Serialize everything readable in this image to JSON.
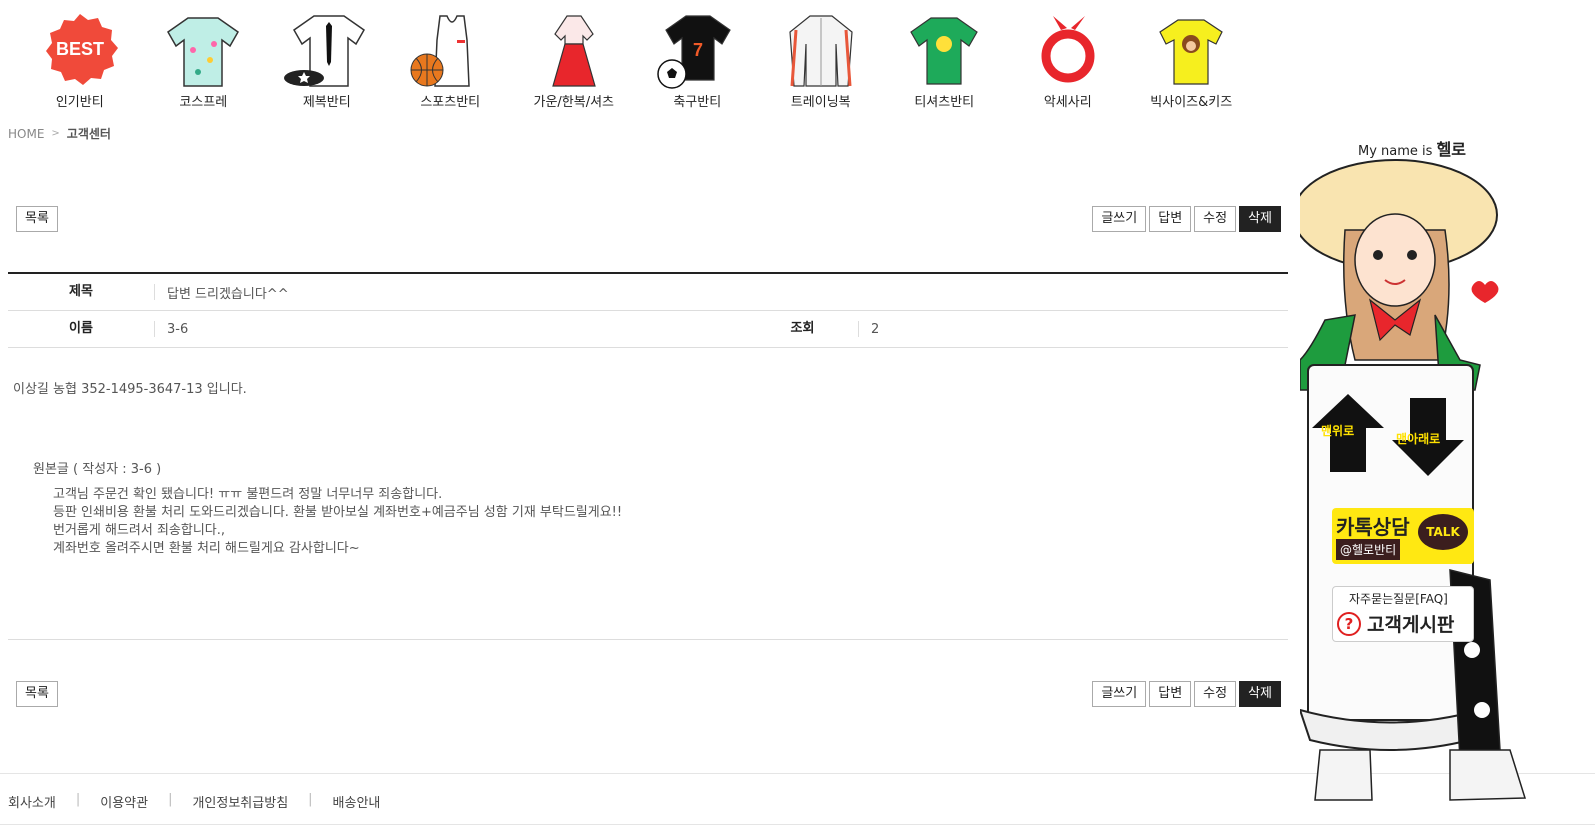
{
  "categories": [
    {
      "label": "인기반티",
      "icon": "best-badge-icon",
      "badge_text": "BEST"
    },
    {
      "label": "코스프레",
      "icon": "hawaiian-shirt-icon"
    },
    {
      "label": "제복반티",
      "icon": "uniform-shirt-icon"
    },
    {
      "label": "스포츠반티",
      "icon": "basketball-jersey-icon"
    },
    {
      "label": "가운/한복/셔츠",
      "icon": "hanbok-icon"
    },
    {
      "label": "축구반티",
      "icon": "soccer-jersey-icon",
      "number": "7"
    },
    {
      "label": "트레이닝복",
      "icon": "track-jacket-icon"
    },
    {
      "label": "티셔츠반티",
      "icon": "green-tshirt-icon"
    },
    {
      "label": "악세사리",
      "icon": "bandana-icon"
    },
    {
      "label": "빅사이즈&키즈",
      "icon": "monkey-tshirt-icon"
    }
  ],
  "breadcrumb": {
    "home": "HOME",
    "current": "고객센터"
  },
  "buttons": {
    "list": "목록",
    "write": "글쓰기",
    "reply": "답변",
    "edit": "수정",
    "delete": "삭제"
  },
  "post": {
    "subject_label": "제목",
    "subject": "답변 드리겠습니다^^",
    "name_label": "이름",
    "name": "3-6",
    "views_label": "조회",
    "views": "2",
    "body": "이상길 농협 352-1495-3647-13 입니다.",
    "original_header": "원본글 ( 작성자 : 3-6 )",
    "original_lines": [
      "고객님 주문건 확인 됐습니다! ㅠㅠ 불편드려 정말 너무너무 죄송합니다.",
      "등판 인쇄비용 환불 처리 도와드리겠습니다. 환불 받아보실 계좌번호+예금주님 성함 기재 부탁드릴게요!!",
      "번거롭게 해드려서 죄송합니다.,",
      "계좌번호 올려주시면 환불 처리 해드릴게요 감사합니다~"
    ]
  },
  "footer": {
    "links": [
      "회사소개",
      "이용약관",
      "개인정보취급방침",
      "배송안내"
    ]
  },
  "side": {
    "myname_prefix": "My name is",
    "myname": "헬로",
    "top_label": "맨위로",
    "bottom_label": "맨아래로",
    "talk_title": "카톡상담",
    "talk_id": "@헬로반티",
    "talk_bubble": "TALK",
    "faq_small": "자주묻는질문[FAQ]",
    "faq_big": "고객게시판",
    "faq_icon": "?"
  },
  "colors": {
    "accent_dark": "#222222",
    "kakao_yellow": "#ffe812",
    "best_red": "#f04a3a"
  }
}
